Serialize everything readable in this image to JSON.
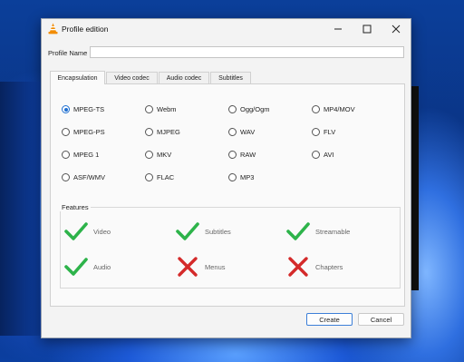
{
  "window": {
    "title": "Profile edition"
  },
  "profile_name": {
    "label": "Profile Name",
    "value": ""
  },
  "tabs": [
    {
      "label": "Encapsulation",
      "active": true
    },
    {
      "label": "Video codec",
      "active": false
    },
    {
      "label": "Audio codec",
      "active": false
    },
    {
      "label": "Subtitles",
      "active": false
    }
  ],
  "encapsulation": {
    "selected": "MPEG-TS",
    "options": [
      "MPEG-TS",
      "Webm",
      "Ogg/Ogm",
      "MP4/MOV",
      "MPEG-PS",
      "MJPEG",
      "WAV",
      "FLV",
      "MPEG 1",
      "MKV",
      "RAW",
      "AVI",
      "ASF/WMV",
      "FLAC",
      "MP3"
    ]
  },
  "features": {
    "label": "Features",
    "items": [
      {
        "label": "Video",
        "supported": true
      },
      {
        "label": "Subtitles",
        "supported": true
      },
      {
        "label": "Streamable",
        "supported": true
      },
      {
        "label": "Audio",
        "supported": true
      },
      {
        "label": "Menus",
        "supported": false
      },
      {
        "label": "Chapters",
        "supported": false
      }
    ]
  },
  "buttons": {
    "create": "Create",
    "cancel": "Cancel"
  },
  "colors": {
    "check": "#2db34a",
    "cross": "#d42a2a",
    "accent": "#1f6fd0"
  }
}
